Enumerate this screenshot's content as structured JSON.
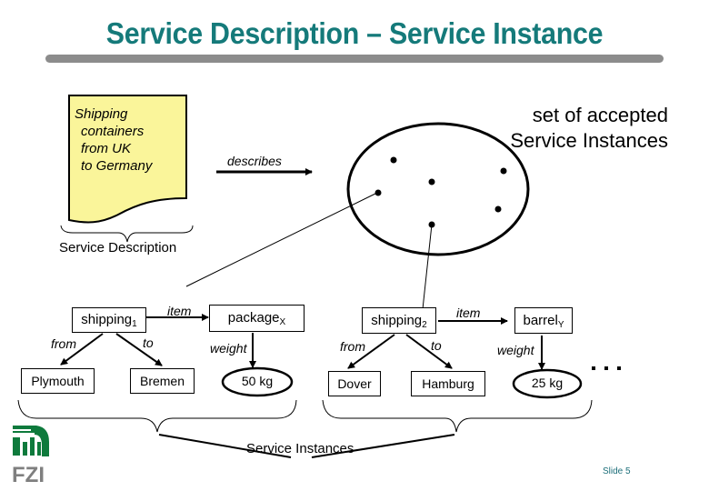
{
  "slide": {
    "title": "Service Description – Service Instance",
    "slide_number": "Slide 5",
    "logo_text": "FZI",
    "colors": {
      "title": "#157a7a",
      "document_fill": "#faf59a",
      "logo_green": "#0e7a3c",
      "logo_gray": "#7f7f7f"
    }
  },
  "description": {
    "lines": [
      "Shipping",
      "containers",
      "from UK",
      "to Germany"
    ],
    "brace_label": "Service Description",
    "arrow_label": "describes"
  },
  "instance_set": {
    "label_line1": "set of accepted",
    "label_line2": "Service Instances",
    "point_count": 6
  },
  "instances": [
    {
      "shipping": "shipping",
      "shipping_sub": "1",
      "item_label": "item",
      "item": "package",
      "item_sub": "X",
      "from_label": "from",
      "from": "Plymouth",
      "to_label": "to",
      "to": "Bremen",
      "weight_label": "weight",
      "weight": "50 kg"
    },
    {
      "shipping": "shipping",
      "shipping_sub": "2",
      "item_label": "item",
      "item": "barrel",
      "item_sub": "Y",
      "from_label": "from",
      "from": "Dover",
      "to_label": "to",
      "to": "Hamburg",
      "weight_label": "weight",
      "weight": "25 kg"
    }
  ],
  "ellipsis": "…",
  "instances_brace_label": "Service Instances"
}
